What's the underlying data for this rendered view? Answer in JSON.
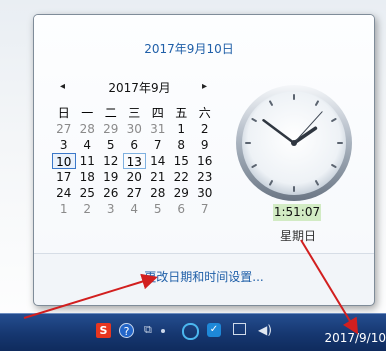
{
  "popup": {
    "date_header": "2017年9月10日",
    "calendar": {
      "prev_icon": "◂",
      "next_icon": "▸",
      "month_title": "2017年9月",
      "weekdays": [
        "日",
        "一",
        "二",
        "三",
        "四",
        "五",
        "六"
      ],
      "days": [
        [
          "27",
          "28",
          "29",
          "30",
          "31",
          "1",
          "2"
        ],
        [
          "3",
          "4",
          "5",
          "6",
          "7",
          "8",
          "9"
        ],
        [
          "10",
          "11",
          "12",
          "13",
          "14",
          "15",
          "16"
        ],
        [
          "17",
          "18",
          "19",
          "20",
          "21",
          "22",
          "23"
        ],
        [
          "24",
          "25",
          "26",
          "27",
          "28",
          "29",
          "30"
        ],
        [
          "1",
          "2",
          "3",
          "4",
          "5",
          "6",
          "7"
        ]
      ]
    },
    "time": "1:51:07",
    "weekday": "星期日",
    "settings_link": "更改日期和时间设置..."
  },
  "taskbar": {
    "date": "2017/9/10",
    "tray": {
      "sogou_label": "S",
      "help_label": "?",
      "cube_label": "⧉",
      "shield_label": "✓",
      "volume_label": "◀)"
    }
  },
  "colors": {
    "accent": "#1f5fa8",
    "time_bg": "#d2ebc4",
    "taskbar": "#163770",
    "annotation_arrow": "#d21f1f"
  }
}
